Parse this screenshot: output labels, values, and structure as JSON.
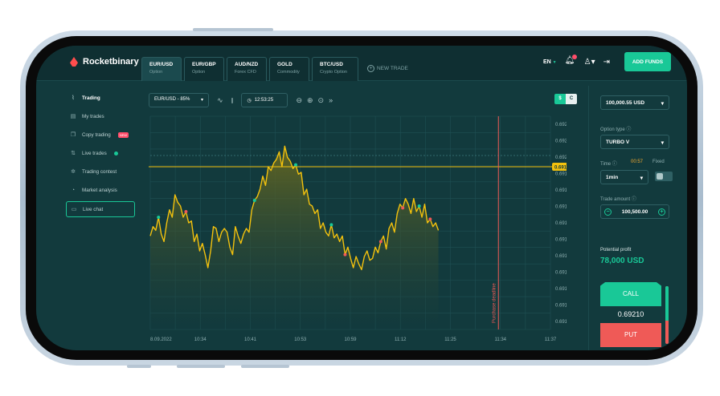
{
  "app": {
    "logo_text": "Rocketbinary"
  },
  "tabs": [
    {
      "pair": "EUR/USD",
      "type": "Option",
      "active": true
    },
    {
      "pair": "EUR/GBP",
      "type": "Option"
    },
    {
      "pair": "AUD/NZD",
      "type": "Forex CFD"
    },
    {
      "pair": "GOLD",
      "type": "Commodity"
    },
    {
      "pair": "BTC/USD",
      "type": "Crypto Option"
    }
  ],
  "new_trade_label": "NEW TRADE",
  "header": {
    "language": "EN",
    "add_funds_label": "ADD FUNDS"
  },
  "sidebar": {
    "items": [
      {
        "label": "Trading",
        "icon": "pulse-icon"
      },
      {
        "label": "My trades",
        "icon": "list-icon"
      },
      {
        "label": "Copy trading",
        "icon": "copy-icon",
        "badge": "NEW"
      },
      {
        "label": "Live trades",
        "icon": "arrows-icon"
      },
      {
        "label": "Trading contest",
        "icon": "trophy-icon"
      },
      {
        "label": "Market analysis",
        "icon": "chart-icon"
      },
      {
        "label": "Live chat",
        "icon": "chat-icon"
      }
    ]
  },
  "toolbar": {
    "asset_select": "EUR/USD - 85%",
    "time": "12:53:25",
    "currency_toggle": [
      "$",
      "C"
    ]
  },
  "chart_data": {
    "type": "area",
    "x_ticks": [
      "8.09.2022",
      "10:34",
      "10:41",
      "10:53",
      "10:59",
      "11:12",
      "11:25",
      "11:34",
      "11:37"
    ],
    "y_ticks": [
      "0.69218",
      "0.69210",
      "0.69201",
      "0.69193",
      "0.69184",
      "0.69175",
      "0.69162",
      "0.69158",
      "0.69150",
      "0.69141",
      "0.69132",
      "0.69124",
      "0.69112"
    ],
    "ylim": [
      0.69108,
      0.69222
    ],
    "current_price_label": "0.69195",
    "current_price": 0.69195,
    "deadline_label": "Purchase deadline",
    "deadline_x": 0.87,
    "colors": {
      "line": "#f4c20d",
      "area_top": "#6b6a1f",
      "area_bottom": "#123a3d",
      "buy": "#19c897",
      "sell": "#ef5a57",
      "deadline": "#ef5a57"
    },
    "series": [
      {
        "values": [
          0.69158,
          0.69163,
          0.69161,
          0.69168,
          0.69159,
          0.69155,
          0.69165,
          0.69172,
          0.69168,
          0.6918,
          0.69176,
          0.69174,
          0.69168,
          0.69171,
          0.69165,
          0.69166,
          0.69155,
          0.69159,
          0.6915,
          0.69154,
          0.69148,
          0.69141,
          0.6915,
          0.69163,
          0.69162,
          0.69155,
          0.6916,
          0.69162,
          0.6916,
          0.69152,
          0.69148,
          0.69163,
          0.69158,
          0.69154,
          0.69159,
          0.69162,
          0.6916,
          0.69172,
          0.69177,
          0.69179,
          0.69183,
          0.6919,
          0.69185,
          0.69195,
          0.69193,
          0.69197,
          0.69199,
          0.69203,
          0.69195,
          0.69206,
          0.692,
          0.69198,
          0.69194,
          0.69196,
          0.69191,
          0.69192,
          0.6918,
          0.69183,
          0.69175,
          0.69174,
          0.6917,
          0.69172,
          0.69162,
          0.69165,
          0.6916,
          0.69158,
          0.69164,
          0.69157,
          0.69159,
          0.69155,
          0.69158,
          0.69148,
          0.69152,
          0.69146,
          0.69141,
          0.69147,
          0.69143,
          0.6914,
          0.69147,
          0.6915,
          0.69145,
          0.69146,
          0.69152,
          0.69149,
          0.69155,
          0.69158,
          0.69151,
          0.69162,
          0.69165,
          0.6916,
          0.6917,
          0.69175,
          0.69173,
          0.69178,
          0.69175,
          0.6917,
          0.69178,
          0.69171,
          0.69174,
          0.69168,
          0.69175,
          0.69165,
          0.69167,
          0.69163,
          0.69165,
          0.69161
        ]
      }
    ],
    "markers": [
      {
        "index": 3,
        "kind": "buy"
      },
      {
        "index": 13,
        "kind": "sell"
      },
      {
        "index": 38,
        "kind": "buy"
      },
      {
        "index": 53,
        "kind": "buy"
      },
      {
        "index": 66,
        "kind": "buy"
      },
      {
        "index": 71,
        "kind": "sell"
      },
      {
        "index": 84,
        "kind": "sell"
      },
      {
        "index": 92,
        "kind": "sell"
      },
      {
        "index": 98,
        "kind": "buy"
      },
      {
        "index": 102,
        "kind": "sell"
      }
    ]
  },
  "right_panel": {
    "balance": "100,000.55 USD",
    "option_type_label": "Option type",
    "option_type": "TURBO V",
    "time_label": "Time",
    "time_remaining": "00:57",
    "fixed_label": "Fixed",
    "duration": "1min",
    "trade_amount_label": "Trade amount",
    "trade_amount": "100,500.00",
    "potential_profit_label": "Potential profit",
    "potential_profit": "78,000 USD",
    "call_label": "CALL",
    "put_label": "PUT",
    "current_rate": "0.69210",
    "call_share": 0.6
  }
}
